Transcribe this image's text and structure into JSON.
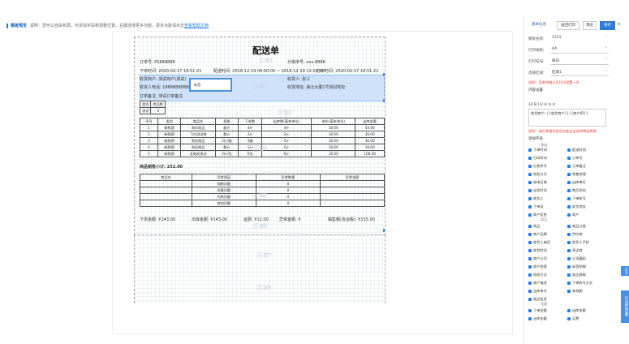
{
  "topbar": {
    "title": "模板预览",
    "desc": "说明：您可以自由布局，可添加字段和调整位置，右键选择更多功能，更多功能请点击",
    "link": "查看帮助文档"
  },
  "doc": {
    "title": "配送单",
    "order_no": "订单号: PS888888",
    "split_no": "分拣序号: xxx-8888",
    "order_time": "下单时间: 2020-02-17 18:51:21",
    "ship_time": "配送时间: 2018-12-19 06:00:00 ~ 2018-12-19 12:00:00",
    "print_time": "打印时间: 2020-02-17 18:51:21",
    "shop_name": "收货商户: 测试商户(测试)",
    "receiver": "收货人: 张三",
    "receiver_phone": "收货人电话: 18888888888",
    "address": "收货地址: 湖北大厦1号测试地址",
    "remark": "订单备注: 测试订单备注",
    "popup_text": "标签",
    "small_table": [
      [
        "类别",
        "商品数"
      ],
      [
        "测试",
        "5"
      ]
    ],
    "headers": [
      "序号",
      "类别",
      "商品名",
      "规格",
      "下单数",
      "出库数(基本单位)",
      "单价(基本单位)",
      "出库金额"
    ],
    "rows": [
      [
        "1",
        "新鲜蔬",
        "测试商品",
        "散斤",
        "4斤",
        "4斤",
        "18.00",
        "54.00"
      ],
      [
        "2",
        "新鲜蔬",
        "飞鸟测试商",
        "散斤",
        "2斤",
        "2斤",
        "18.00",
        "36.00"
      ],
      [
        "3",
        "新鲜蔬",
        "测试商品",
        "2斤/箱",
        "2箱",
        "2斤",
        "18.00",
        "36.00"
      ],
      [
        "4",
        "新鲜蔬",
        "测试商品",
        "散斤",
        "1斤",
        "1斤",
        "18.00",
        "18.00"
      ],
      [
        "5",
        "新鲜蔬",
        "无锡发测试",
        "2斤/包",
        "6包",
        "6斤",
        "18.00",
        "108.00"
      ]
    ],
    "total": "商品销售小计: 252.00",
    "ex_headers": [
      "商品名",
      "异常原因",
      "异常数量",
      "异常金额"
    ],
    "ex_rows": [
      [
        "",
        "规格问题",
        "0",
        ""
      ],
      [
        "",
        "质量问题",
        "0",
        ""
      ],
      [
        "",
        "包装问题",
        "0",
        ""
      ],
      [
        "",
        "其他问题",
        "0",
        ""
      ]
    ],
    "footer": [
      "下单金额: ¥143.00",
      "出库金额: ¥143.00",
      "运费: ¥12.00",
      "异常金额: ¥",
      "销售额(含运税): ¥155.00"
    ],
    "watermarks": [
      "区域1",
      "区域2",
      "区域3",
      "区域4",
      "区域5",
      "区域6",
      "区域7",
      "区域8"
    ]
  },
  "panel": {
    "tabs": [
      "基本信息",
      "返回打印",
      "预览",
      "保存"
    ],
    "name_label": "模板名称:",
    "name_value": "1111",
    "size_label": "打印规格:",
    "size_value": "A4",
    "dir_label": "打印布局:",
    "dir_value": "纵向",
    "type_label": "选择区域:",
    "type_value": "区域1",
    "warn1": "说明：用来控制分页打印设置一次",
    "section_title": "内容设置",
    "format_bar": "12  B  I  U   ≡  ≡  ≡",
    "preview_text": "收货商户: {{收货商户}}{{商户ID}}",
    "warn2": "说明：请在表格外部空白处右击选择增加表格",
    "add_field": "添加字段",
    "group1": "基础",
    "fields1": [
      "下单时间",
      "配送时间",
      "打印时间",
      "订单号",
      "分拣序号",
      "订单备注",
      "结款方式",
      "销售经理",
      "城市区域",
      "出库单位",
      "出货时间",
      "售后状态",
      "收货人",
      "下单账号",
      "下单员",
      "收货地址",
      "商户信息",
      "商户"
    ],
    "group2": "商品",
    "fields2": [
      "商品",
      "商品分类",
      "商户品牌",
      "供应商",
      "收货人电话",
      "收货人手机",
      "收货时间",
      "承运商",
      "商户公司",
      "公司编码",
      "商户经营",
      "标签明细",
      "结款方式",
      "商品规格",
      "商户描述",
      "下单账号方式",
      "出库单号",
      "有效期",
      "商品信息"
    ],
    "group3": "金额",
    "fields3": [
      "下单金额",
      "出库金额",
      "出库金额",
      "运费"
    ],
    "side1": "打开",
    "side2": "打印模板设置"
  },
  "colors": {
    "accent": "#2f7bd6",
    "highlight": "#cfe2f9",
    "warn": "#e33333"
  }
}
